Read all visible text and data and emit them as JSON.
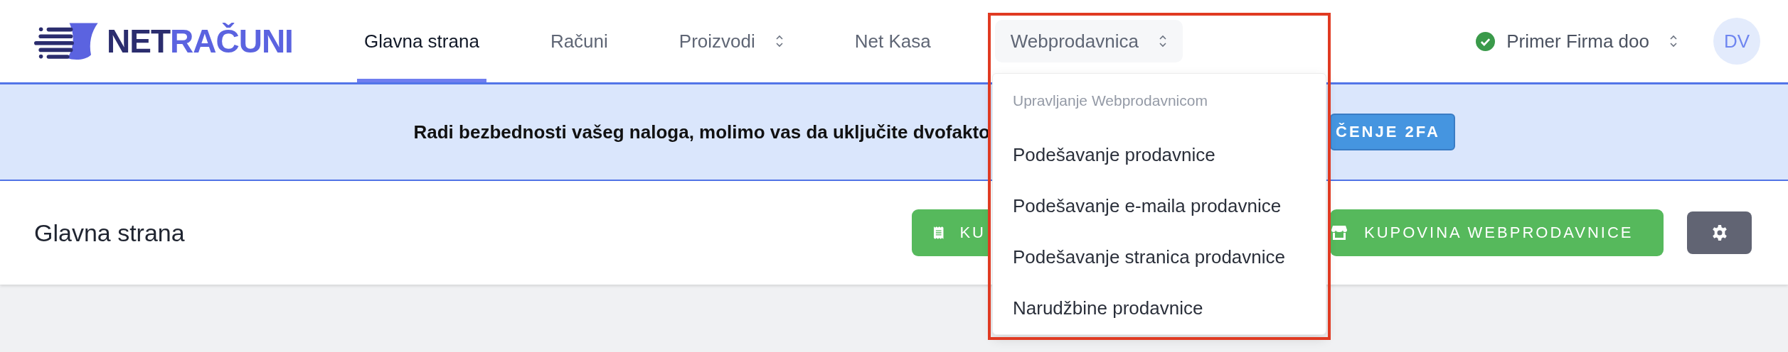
{
  "logo": {
    "parts": [
      {
        "text": "NET",
        "color": "#2b2d6e"
      },
      {
        "text": "RAČUNI",
        "color": "#5b63e0"
      }
    ]
  },
  "nav": [
    {
      "label": "Glavna strana",
      "selected": true,
      "dropdown": false
    },
    {
      "label": "Računi",
      "selected": false,
      "dropdown": false
    },
    {
      "label": "Proizvodi",
      "selected": false,
      "dropdown": true
    },
    {
      "label": "Net Kasa",
      "selected": false,
      "dropdown": false
    },
    {
      "label": "Webprodavnica",
      "selected": false,
      "dropdown": true,
      "open": true
    }
  ],
  "company": {
    "name": "Primer Firma doo",
    "verified": true
  },
  "avatar": {
    "initials": "DV"
  },
  "banner": {
    "text": "Radi bezbednosti vašeg naloga, molimo vas da uključite dvofakto",
    "button": "ČENJE 2FA"
  },
  "page": {
    "title": "Glavna strana",
    "buttons": [
      {
        "kind": "receipt",
        "label": "KU"
      },
      {
        "kind": "shop",
        "label": "KUPOVINA WEBPRODAVNICE"
      },
      {
        "kind": "settings"
      }
    ]
  },
  "dropdown": {
    "header": "Upravljanje Webprodavnicom",
    "items": [
      "Podešavanje prodavnice",
      "Podešavanje e-maila prodavnice",
      "Podešavanje stranica prodavnice",
      "Narudžbine prodavnice"
    ],
    "highlighted": true
  }
}
